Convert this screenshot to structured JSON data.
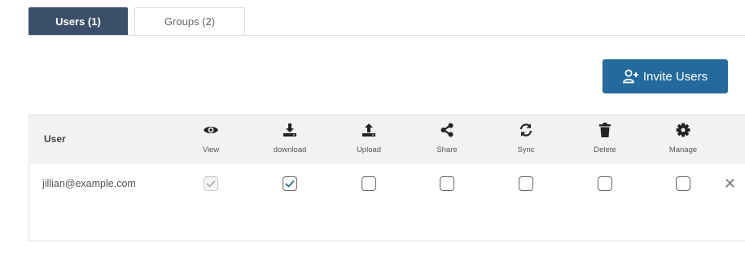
{
  "tabs": [
    {
      "label": "Users (1)",
      "active": true
    },
    {
      "label": "Groups (2)",
      "active": false
    }
  ],
  "invite_button": {
    "label": "Invite Users",
    "icon": "add-user-icon",
    "color": "#246a9c"
  },
  "table": {
    "user_header": "User",
    "columns": [
      {
        "label": "View",
        "icon": "eye-icon"
      },
      {
        "label": "download",
        "icon": "download-icon"
      },
      {
        "label": "Upload",
        "icon": "upload-icon"
      },
      {
        "label": "Share",
        "icon": "share-icon"
      },
      {
        "label": "Sync",
        "icon": "sync-icon"
      },
      {
        "label": "Delete",
        "icon": "trash-icon"
      },
      {
        "label": "Manage",
        "icon": "gear-icon"
      }
    ],
    "rows": [
      {
        "email": "jillian@example.com",
        "permissions": {
          "view": {
            "checked": true,
            "disabled": true
          },
          "download": {
            "checked": true,
            "disabled": false
          },
          "upload": {
            "checked": false,
            "disabled": false
          },
          "share": {
            "checked": false,
            "disabled": false
          },
          "sync": {
            "checked": false,
            "disabled": false
          },
          "delete": {
            "checked": false,
            "disabled": false
          },
          "manage": {
            "checked": false,
            "disabled": false
          }
        }
      }
    ]
  },
  "colors": {
    "tab_active": "#3c4f6a",
    "header_bg": "#f2f2f2"
  }
}
